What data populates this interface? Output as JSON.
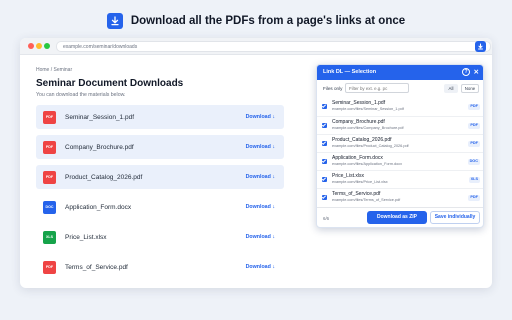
{
  "promo": {
    "title": "Download all the PDFs from a page's links at once",
    "icon": "download-icon",
    "accent": "#2563eb"
  },
  "browser": {
    "url": "example.com/seminar/downloads",
    "extension_button_icon": "extension-download-icon"
  },
  "page": {
    "breadcrumb": "Home / Seminar",
    "title": "Seminar Document Downloads",
    "subtitle": "You can download the materials below.",
    "files": [
      {
        "badge": "PDF",
        "badge_color": "#ef4444",
        "name": "Seminar_Session_1.pdf",
        "action": "Download ↓",
        "highlighted": true
      },
      {
        "badge": "PDF",
        "badge_color": "#ef4444",
        "name": "Company_Brochure.pdf",
        "action": "Download ↓",
        "highlighted": true
      },
      {
        "badge": "PDF",
        "badge_color": "#ef4444",
        "name": "Product_Catalog_2026.pdf",
        "action": "Download ↓",
        "highlighted": true
      },
      {
        "badge": "DOC",
        "badge_color": "#2563eb",
        "name": "Application_Form.docx",
        "action": "Download ↓",
        "highlighted": false
      },
      {
        "badge": "XLS",
        "badge_color": "#16a34a",
        "name": "Price_List.xlsx",
        "action": "Download ↓",
        "highlighted": false
      },
      {
        "badge": "PDF",
        "badge_color": "#ef4444",
        "name": "Terms_of_Service.pdf",
        "action": "Download ↓",
        "highlighted": false
      }
    ]
  },
  "popup": {
    "title": "Link DL — Selection",
    "help_icon": "?",
    "close_icon": "✕",
    "files_only_label": "Files only",
    "filter_placeholder": "Filter by ext. e.g. pc",
    "all_label": "All",
    "none_label": "None",
    "items": [
      {
        "name": "Seminar_Session_1.pdf",
        "url": "example.com/files/Seminar_Session_1.pdf",
        "type": "PDF",
        "checked": true
      },
      {
        "name": "Company_Brochure.pdf",
        "url": "example.com/files/Company_Brochure.pdf",
        "type": "PDF",
        "checked": true
      },
      {
        "name": "Product_Catalog_2026.pdf",
        "url": "example.com/files/Product_Catalog_2026.pdf",
        "type": "PDF",
        "checked": true
      },
      {
        "name": "Application_Form.docx",
        "url": "example.com/files/Application_Form.docx",
        "type": "DOC",
        "checked": true
      },
      {
        "name": "Price_List.xlsx",
        "url": "example.com/files/Price_List.xlsx",
        "type": "XLS",
        "checked": true
      },
      {
        "name": "Terms_of_Service.pdf",
        "url": "example.com/files/Terms_of_Service.pdf",
        "type": "PDF",
        "checked": true
      }
    ],
    "selected_count": "6/6",
    "zip_button": "Download as ZIP",
    "individual_button": "Save individually"
  }
}
